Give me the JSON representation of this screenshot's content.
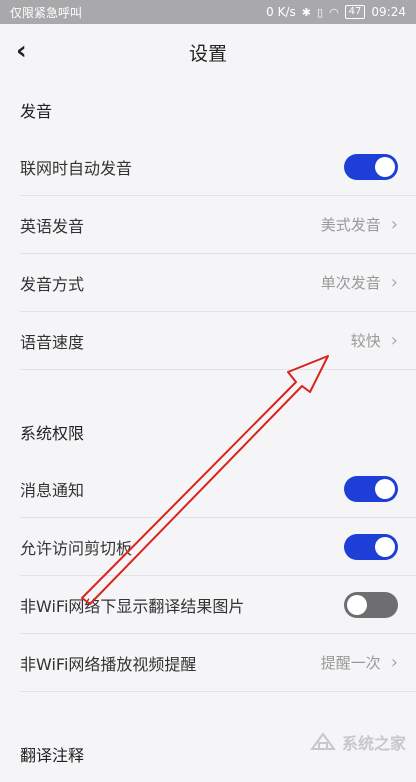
{
  "status_bar": {
    "carrier": "仅限紧急呼叫",
    "speed": "0 K/s",
    "battery": "47",
    "time": "09:24"
  },
  "nav": {
    "title": "设置"
  },
  "sections": [
    {
      "header": "发音",
      "rows": [
        {
          "label": "联网时自动发音",
          "type": "toggle",
          "on": true
        },
        {
          "label": "英语发音",
          "type": "value",
          "value": "美式发音"
        },
        {
          "label": "发音方式",
          "type": "value",
          "value": "单次发音"
        },
        {
          "label": "语音速度",
          "type": "value",
          "value": "较快"
        }
      ]
    },
    {
      "header": "系统权限",
      "rows": [
        {
          "label": "消息通知",
          "type": "toggle",
          "on": true
        },
        {
          "label": "允许访问剪切板",
          "type": "toggle",
          "on": true
        },
        {
          "label": "非WiFi网络下显示翻译结果图片",
          "type": "toggle",
          "on": false
        },
        {
          "label": "非WiFi网络播放视频提醒",
          "type": "value",
          "value": "提醒一次"
        }
      ]
    },
    {
      "header": "翻译注释",
      "rows": []
    }
  ],
  "colors": {
    "toggle_on": "#1e3ed8",
    "toggle_off": "#6e6e70",
    "annotation": "#d9231d"
  },
  "watermark": "系统之家"
}
